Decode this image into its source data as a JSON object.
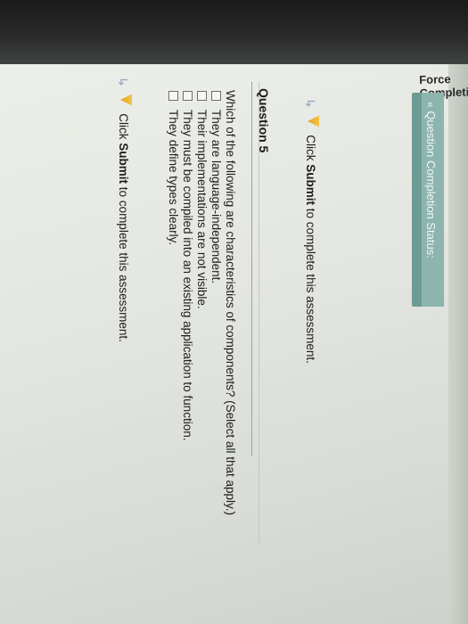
{
  "page": {
    "partial_heading": "Force Completion",
    "completion_link": "Question Completion Status:",
    "top_warning": {
      "prefix": "Click",
      "bold": "Submit",
      "suffix": "to complete this assessment."
    },
    "question": {
      "label": "Question 5",
      "prompt": "Which of the following are characteristics of components? (Select all that apply.)",
      "options": [
        "They are language-independent.",
        "Their implementations are not visible.",
        "They must be compiled into an existing application to function.",
        "They define types clearly."
      ]
    },
    "bottom_warning": {
      "prefix": "Click",
      "bold": "Submit",
      "suffix": "to complete this assessment."
    }
  },
  "colors": {
    "completion_bar": "#6b9b92",
    "warning_icon": "#e7a21c",
    "screen_bg": "#e4e6e1"
  },
  "icons": {
    "warning": "warning-triangle-icon",
    "redo": "redo-arrow-icon",
    "expand": "double-chevron-icon"
  }
}
